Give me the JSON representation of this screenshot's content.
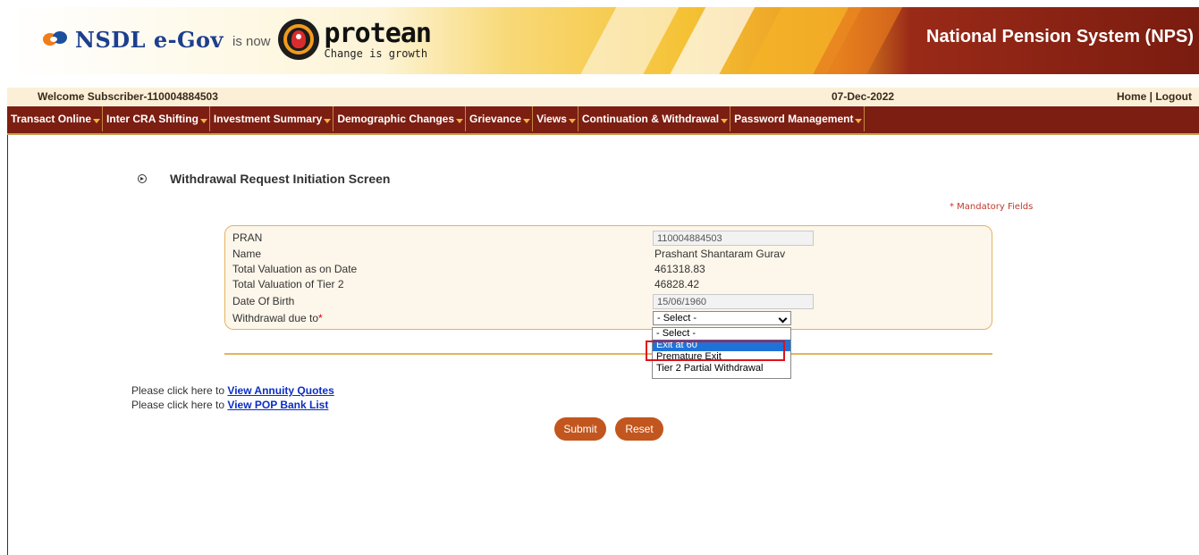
{
  "header": {
    "nsdl_brand": "NSDL e-Gov",
    "is_now": "is now",
    "protean_brand": "protean",
    "protean_tagline": "Change is growth",
    "system_title": "National Pension System (NPS)"
  },
  "infobar": {
    "welcome": "Welcome Subscriber-110004884503",
    "date": "07-Dec-2022",
    "home_logout": "Home | Logout"
  },
  "menu": {
    "items": [
      {
        "label": "Transact Online"
      },
      {
        "label": "Inter CRA Shifting"
      },
      {
        "label": "Investment Summary"
      },
      {
        "label": "Demographic Changes"
      },
      {
        "label": "Grievance"
      },
      {
        "label": "Views"
      },
      {
        "label": "Continuation & Withdrawal"
      },
      {
        "label": "Password Management"
      }
    ]
  },
  "page": {
    "title": "Withdrawal Request Initiation Screen",
    "mandatory_note": "* Mandatory Fields"
  },
  "form": {
    "pran_label": "PRAN",
    "pran_value": "110004884503",
    "name_label": "Name",
    "name_value": "Prashant Shantaram Gurav",
    "total_valuation_label": "Total Valuation as on Date",
    "total_valuation_value": "461318.83",
    "tier2_valuation_label": "Total Valuation of Tier 2",
    "tier2_valuation_value": "46828.42",
    "dob_label": "Date Of Birth",
    "dob_value": "15/06/1960",
    "withdrawal_label": "Withdrawal due to",
    "required_marker": "*",
    "withdrawal_selected": "- Select -",
    "withdrawal_options": [
      {
        "label": "- Select -"
      },
      {
        "label": "Exit at 60"
      },
      {
        "label": "Premature Exit"
      },
      {
        "label": "Tier 2 Partial Withdrawal"
      }
    ]
  },
  "links": {
    "prefix": "Please click here to",
    "annuity": "View Annuity Quotes",
    "pop_bank": "View POP Bank List"
  },
  "buttons": {
    "submit": "Submit",
    "reset": "Reset"
  },
  "colors": {
    "menu_bg": "#7c1e12",
    "button_bg": "#c2561e",
    "highlight": "#e0101b",
    "option_selected": "#1e73d8"
  }
}
